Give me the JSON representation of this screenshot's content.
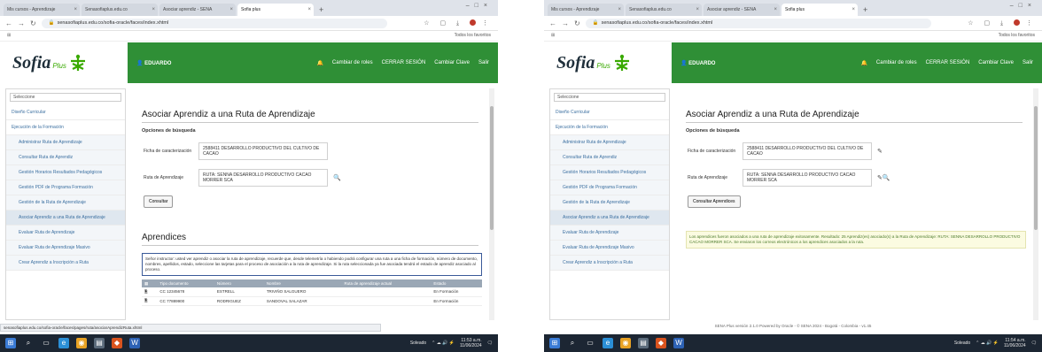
{
  "colors": {
    "brand_green": "#2f8f36",
    "logo_green": "#39a900",
    "taskbar": "#1c2633",
    "link_blue": "#3b6fa0"
  },
  "left": {
    "tabs": [
      "Mis cursos - Aprendizaje",
      "Senasofiaplus.edu.co",
      "Asociar aprendiz - SENA",
      "Sofia plus"
    ],
    "address": "senasofiaplus.edu.co/sofia-oracle/faces/index.xhtml",
    "bookmarks_right": "Todos los favoritos",
    "header": {
      "user": "EDUARDO",
      "menu": [
        "Cambiar de roles",
        "CERRAR SESIÓN",
        "Cambiar Clave",
        "Salir"
      ]
    },
    "sidebar": {
      "select": "Seleccione",
      "items": [
        "Diseño Curricular",
        "Ejecución de la Formación",
        "Administrar Ruta de Aprendizaje",
        "Consultar Ruta de Aprendiz",
        "Gestión Horarios Resultados Pedagógicos",
        "Gestión PDF de Programa Formación",
        "Gestión de la Ruta de Aprendizaje",
        "Asociar Aprendiz a una Ruta de Aprendizaje",
        "Evaluar Ruta de Aprendizaje",
        "Evaluar Ruta de Aprendizaje Masivo",
        "Crear Aprendiz a Inscripción a Ruta"
      ]
    },
    "title": "Asociar Aprendiz a una Ruta de Aprendizaje",
    "subtitle": "Opciones de búsqueda",
    "field1_label": "Ficha de caracterización",
    "field1_value": "2588411 DESARROLLO PRODUCTIVO DEL CULTIVO DE CACAO",
    "field2_label": "Ruta de Aprendizaje",
    "field2_value": "RUTA: SENNA DESARROLLO PRODUCTIVO CACAO MORRER SCA",
    "button": "Consultar",
    "section": "Aprendices",
    "notice": "Señor instructor: usted ver aprendiz o asociar la ruta de aprendizaje, recuerde que, desde telemetría o habiendo podrá configurar una ruta a una ficha de formación, número de documento, nombres, apellidos, estado, seleccione las tarjetas para el proceso de asociación a la ruta de aprendizaje. Si la ruta seleccionada ya fue asociada tendrá el estado de aprendiz asociado al proceso.",
    "table_headers": [
      "",
      "Tipo documento",
      "Número",
      "Nombre",
      "Ruta de aprendizaje actual",
      "Estado"
    ],
    "rows": [
      [
        "CC 12345678",
        "ESTRELL",
        "TRIVIÑO SALGUERO",
        "En Formación"
      ],
      [
        "CC 77889900",
        "RODRIGUEZ",
        "SANDOVAL SALAZAR",
        "En Formación"
      ]
    ],
    "status_url": "senasofiaplus.edu.co/sofia-oracle/faces/pages/ruta/asociarAprendizRuta.xhtml",
    "taskbar": {
      "weather": "Soleado",
      "time": "11:53 a.m.",
      "date": "11/06/2024"
    }
  },
  "right": {
    "tabs": [
      "Mis cursos - Aprendizaje",
      "Senasofiaplus.edu.co",
      "Asociar aprendiz - SENA",
      "Sofia plus"
    ],
    "address": "senasofiaplus.edu.co/sofia-oracle/faces/index.xhtml",
    "bookmarks_right": "Todos los favoritos",
    "header": {
      "user": "EDUARDO",
      "menu": [
        "Cambiar de roles",
        "CERRAR SESIÓN",
        "Cambiar Clave",
        "Salir"
      ]
    },
    "sidebar": {
      "select": "Seleccione",
      "items": [
        "Diseño Curricular",
        "Ejecución de la Formación",
        "Administrar Ruta de Aprendizaje",
        "Consultar Ruta de Aprendiz",
        "Gestión Horarios Resultados Pedagógicos",
        "Gestión PDF de Programa Formación",
        "Gestión de la Ruta de Aprendizaje",
        "Asociar Aprendiz a una Ruta de Aprendizaje",
        "Evaluar Ruta de Aprendizaje",
        "Evaluar Ruta de Aprendizaje Masivo",
        "Crear Aprendiz a Inscripción a Ruta"
      ]
    },
    "title": "Asociar Aprendiz a una Ruta de Aprendizaje",
    "subtitle": "Opciones de búsqueda",
    "field1_label": "Ficha de caracterización",
    "field1_value": "2588411 DESARROLLO PRODUCTIVO DEL CULTIVO DE CACAO",
    "field2_label": "Ruta de Aprendizaje",
    "field2_value": "RUTA: SENNA DESARROLLO PRODUCTIVO CACAO MORRER SCA",
    "button": "Consultar Aprendices",
    "success": "Los aprendices fueron asociados a una ruta de aprendizaje exitosamente. Resultado: 25 Aprendiz(es) asociado(s) a la Ruta de Aprendizaje: RUTA: SENNA DESARROLLO PRODUCTIVO CACAO MORRER SCA. Se enviaron los correos electrónicos a los aprendices asociados a la ruta.",
    "footer": "SENA Plus versión 2.1.0 Powered by Oracle - © SENA 2024 - Bogotá - Colombia - v1.45",
    "taskbar": {
      "weather": "Soleado",
      "time": "11:54 a.m.",
      "date": "11/06/2024"
    }
  }
}
